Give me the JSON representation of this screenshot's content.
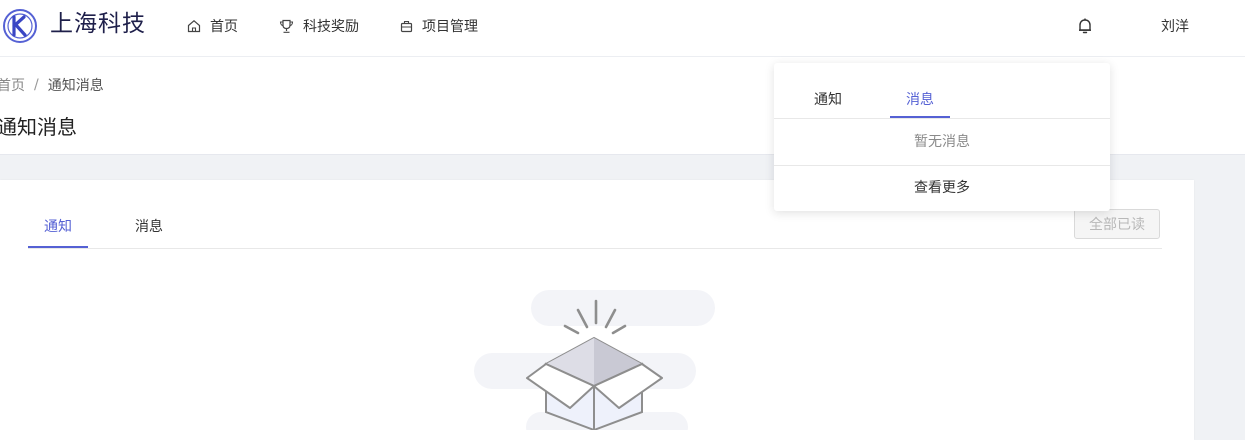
{
  "header": {
    "brand": "上海科技",
    "nav": [
      {
        "label": "首页",
        "icon": "home-icon"
      },
      {
        "label": "科技奖励",
        "icon": "trophy-icon"
      },
      {
        "label": "项目管理",
        "icon": "briefcase-icon"
      }
    ],
    "user_name": "刘洋"
  },
  "breadcrumb": {
    "home": "首页",
    "separator": "/",
    "current": "通知消息"
  },
  "page_title": "通知消息",
  "main": {
    "tabs": [
      {
        "label": "通知",
        "active": true
      },
      {
        "label": "消息",
        "active": false
      }
    ],
    "mark_all_read": "全部已读"
  },
  "popover": {
    "tabs": [
      {
        "label": "通知",
        "active": false
      },
      {
        "label": "消息",
        "active": true
      }
    ],
    "empty_text": "暂无消息",
    "view_more": "查看更多"
  },
  "colors": {
    "accent": "#5561d4",
    "brand_text": "#1e1f4a"
  }
}
